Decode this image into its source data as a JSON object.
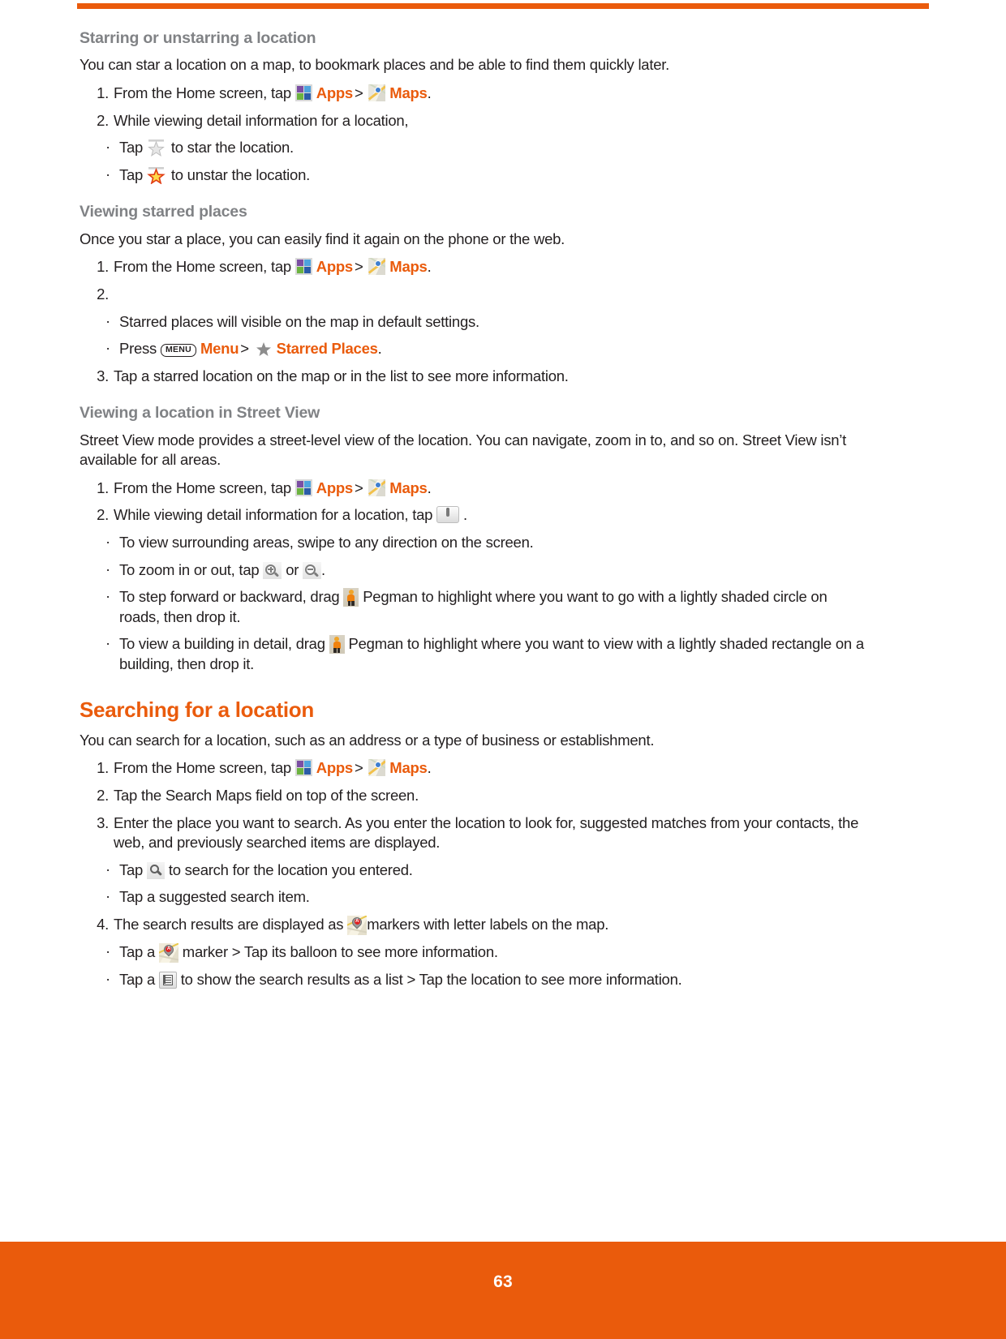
{
  "page": {
    "number": "63",
    "accent_color": "#ea5b0c",
    "subhead_color": "#808285",
    "body_color": "#231f20"
  },
  "sections": [
    {
      "id": "starring",
      "heading": "Starring or unstarring a location",
      "intro": "You can star a location on a map, to bookmark places and be able to find them quickly later.",
      "step1_num": "1.",
      "step1_a": "From the Home screen, tap",
      "step1_apps": "Apps",
      "step1_gt": ">",
      "step1_maps": "Maps",
      "step1_end": ".",
      "step2_num": "2.",
      "step2_text": "While viewing detail information for a location,",
      "bullet1_a": "Tap",
      "bullet1_b": "to star the location.",
      "bullet2_a": "Tap",
      "bullet2_b": "to unstar the location."
    },
    {
      "id": "starred-places",
      "heading": "Viewing starred places",
      "intro": "Once you star a place, you can easily find it again on the phone or the web.",
      "step1_num": "1.",
      "step1_a": "From the Home screen, tap",
      "step1_apps": "Apps",
      "step1_gt": ">",
      "step1_maps": "Maps",
      "step1_end": ".",
      "step2_num": "2.",
      "step2_text": "",
      "bullet1": "Starred places will visible on the map in default settings.",
      "bullet2_a": "Press",
      "bullet2_key": "MENU",
      "bullet2_menu": "Menu",
      "bullet2_gt": ">",
      "bullet2_starred": "Starred Places",
      "bullet2_end": ".",
      "step3_num": "3.",
      "step3_text": "Tap a starred location on the map or in the list to see more information."
    },
    {
      "id": "street-view",
      "heading": "Viewing a location in Street View",
      "intro": "Street View mode provides a street-level view of the location. You can navigate, zoom in to, and so on. Street View isn’t available for all areas.",
      "step1_num": "1.",
      "step1_a": "From the Home screen, tap",
      "step1_apps": "Apps",
      "step1_gt": ">",
      "step1_maps": "Maps",
      "step1_end": ".",
      "step2_num": "2.",
      "step2_a": "While viewing detail information for a location, tap",
      "step2_b": ".",
      "bullet1": "To view surrounding areas, swipe to any direction on the screen.",
      "bullet2_a": "To zoom in or out, tap",
      "bullet2_or": "or",
      "bullet2_end": ".",
      "bullet3_a": "To step forward or backward, drag",
      "bullet3_b": "Pegman to highlight where you want to go with a lightly shaded circle on roads, then drop it.",
      "bullet4_a": "To view a building in detail, drag",
      "bullet4_b": "Pegman to highlight where you want to view with a lightly shaded rectangle on a building, then drop it."
    },
    {
      "id": "searching",
      "heading": "Searching for a location",
      "intro": "You can search for a location, such as an address or a type of business or establishment.",
      "step1_num": "1.",
      "step1_a": "From the Home screen, tap",
      "step1_apps": "Apps",
      "step1_gt": ">",
      "step1_maps": "Maps",
      "step1_end": ".",
      "step2_num": "2.",
      "step2_text": "Tap the Search Maps field on top of the screen.",
      "step3_num": "3.",
      "step3_text": "Enter the place you want to search. As you enter the location to look for, suggested matches from your contacts, the web, and previously searched items are displayed.",
      "bullet1_a": "Tap",
      "bullet1_b": "to search for the location you entered.",
      "bullet2": "Tap a suggested search item.",
      "step4_num": "4.",
      "step4_a": "The search results are displayed as",
      "step4_b": "markers with letter labels on the map.",
      "bullet3_a": "Tap a",
      "bullet3_b": "marker > Tap its balloon to see more information.",
      "bullet4_a": "Tap a",
      "bullet4_b": "to show the search results as a list > Tap the location to see more information."
    }
  ],
  "icons": {
    "apps": "apps-grid-icon",
    "maps": "maps-icon",
    "star_empty": "star-outline-icon",
    "star_filled": "star-filled-icon",
    "star_grey": "star-grey-icon",
    "menu_key": "menu-key-icon",
    "street_view": "street-view-button-icon",
    "zoom_in": "zoom-in-icon",
    "zoom_out": "zoom-out-icon",
    "pegman": "pegman-icon",
    "search": "search-icon",
    "marker": "map-marker-a-icon",
    "list": "list-view-icon"
  },
  "marker_letter": "A"
}
